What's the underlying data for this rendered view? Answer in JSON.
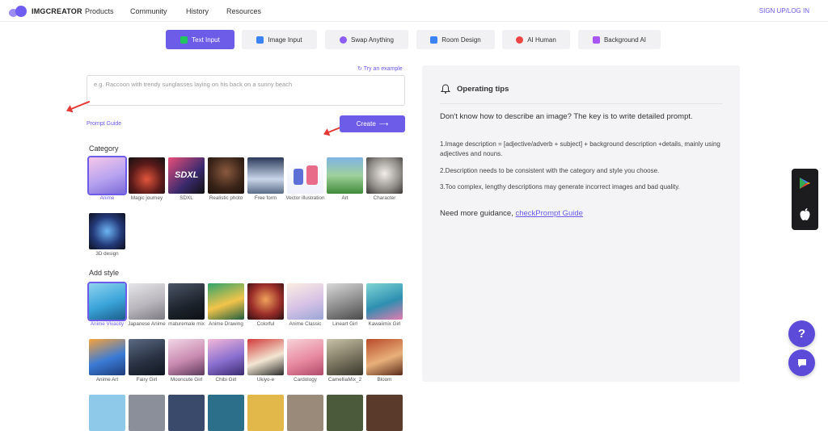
{
  "nav": {
    "logo": "IMGCREATOR",
    "items": [
      "Products",
      "Community",
      "History",
      "Resources"
    ],
    "signup": "SIGN UP/LOG IN"
  },
  "tabs": [
    {
      "label": "Text Input",
      "icon": "text-icon",
      "color": "#22c55e"
    },
    {
      "label": "Image Input",
      "icon": "image-icon",
      "color": "#3b82f6"
    },
    {
      "label": "Swap Anything",
      "icon": "swap-icon",
      "color": "#8b5cf6"
    },
    {
      "label": "Room Design",
      "icon": "home-icon",
      "color": "#3b82f6"
    },
    {
      "label": "AI Human",
      "icon": "person-icon",
      "color": "#ef4444"
    },
    {
      "label": "Background AI",
      "icon": "layers-icon",
      "color": "#a855f7"
    }
  ],
  "editor": {
    "try_example": "Try an example",
    "placeholder": "e.g. Raccoon with trendy sunglasses laying on his back on a sunny beach",
    "prompt_guide": "Prompt Guide",
    "create": "Create"
  },
  "category": {
    "title": "Category",
    "items": [
      {
        "label": "Anime"
      },
      {
        "label": "Magic journey"
      },
      {
        "label": "SDXL"
      },
      {
        "label": "Realistic photo"
      },
      {
        "label": "Free form"
      },
      {
        "label": "Vector illustration"
      },
      {
        "label": "Art"
      },
      {
        "label": "Character"
      },
      {
        "label": "3D design"
      }
    ]
  },
  "style": {
    "title": "Add style",
    "items": [
      {
        "label": "Anime Vivacity"
      },
      {
        "label": "Japanese Anime"
      },
      {
        "label": "maturemale mix"
      },
      {
        "label": "Anime Drawing"
      },
      {
        "label": "Colorful"
      },
      {
        "label": "Anime Classic"
      },
      {
        "label": "Lineart Girl"
      },
      {
        "label": "Kawaiimix Girl"
      },
      {
        "label": "Anime Art"
      },
      {
        "label": "Fairy Girl"
      },
      {
        "label": "Mooncute Girl"
      },
      {
        "label": "Chibi Girl"
      },
      {
        "label": "Ukiyo-e"
      },
      {
        "label": "Cardology"
      },
      {
        "label": "CamelliaMix_2"
      },
      {
        "label": "Bloom"
      }
    ]
  },
  "tips": {
    "title": "Operating tips",
    "lead": "Don't know how to describe an image? The key is to write detailed prompt.",
    "p1": "1.Image description = [adjective/adverb + subject] + background description +details, mainly using adjectives and nouns.",
    "p2": "2.Description needs to be consistent with the category and style you choose.",
    "p3": "3.Too complex, lengthy descriptions may generate incorrect images and bad quality.",
    "more": "Need more guidance,",
    "more_link": "checkPrompt Guide"
  },
  "floating": {
    "help": "?"
  }
}
